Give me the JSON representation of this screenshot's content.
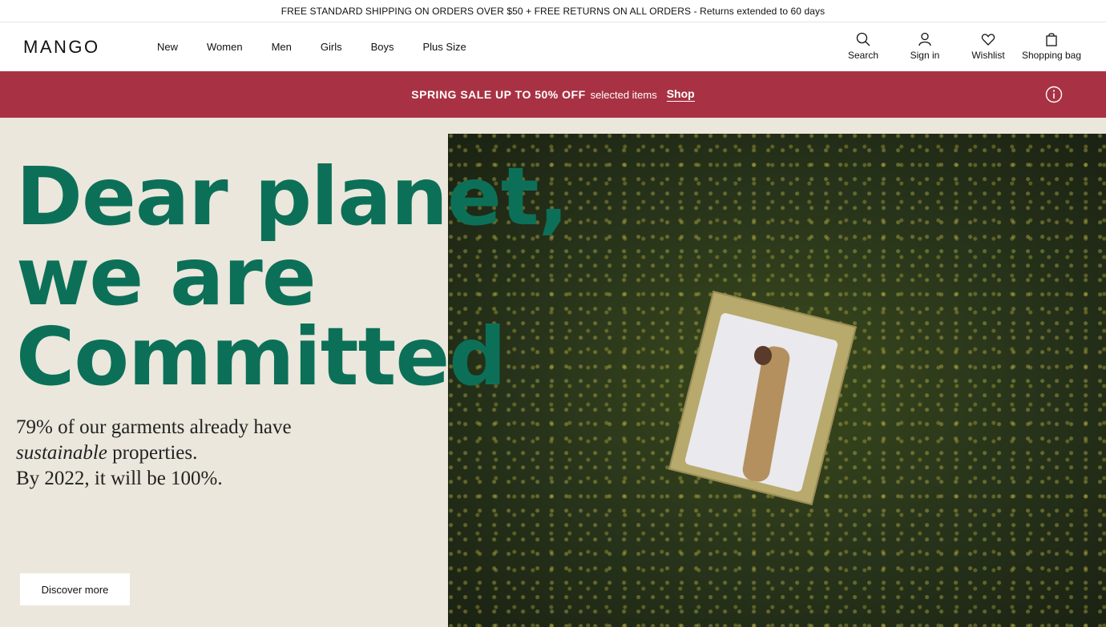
{
  "topbar": {
    "text": "FREE STANDARD SHIPPING ON ORDERS OVER $50 + FREE RETURNS ON ALL ORDERS - Returns extended to 60 days"
  },
  "header": {
    "logo": "MANGO",
    "nav": [
      {
        "label": "New"
      },
      {
        "label": "Women"
      },
      {
        "label": "Men"
      },
      {
        "label": "Girls"
      },
      {
        "label": "Boys"
      },
      {
        "label": "Plus Size"
      }
    ],
    "actions": {
      "search": "Search",
      "sign_in": "Sign in",
      "wishlist": "Wishlist",
      "bag": "Shopping bag"
    }
  },
  "promo": {
    "strong": "SPRING SALE UP TO 50% OFF",
    "light": "selected items",
    "shop": "Shop",
    "info_icon": "info-icon"
  },
  "hero": {
    "headline": [
      "Dear planet,",
      "we are",
      "Committed"
    ],
    "sub_line1": "79% of our garments already have",
    "sub_italic": "sustainable",
    "sub_line2_rest": " properties.",
    "sub_line3": "By 2022, it will be 100%.",
    "cta": "Discover more"
  },
  "colors": {
    "promo_bg": "#a83243",
    "headline": "#0c7058",
    "hero_bg": "#ebe7dc"
  }
}
